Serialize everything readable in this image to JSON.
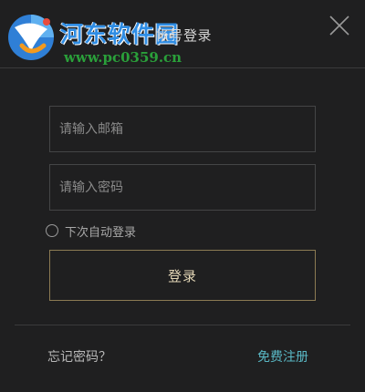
{
  "window": {
    "title": "帐号登录",
    "close_icon": "close-icon"
  },
  "watermark": {
    "name": "河东软件园",
    "url": "www.pc0359.cn",
    "logo_icon": "globe-logo-icon"
  },
  "form": {
    "email_placeholder": "请输入邮箱",
    "email_value": "",
    "password_placeholder": "请输入密码",
    "password_value": "",
    "remember_label": "下次自动登录",
    "remember_checked": false,
    "login_label": "登录"
  },
  "footer": {
    "forgot_label": "忘记密码？",
    "register_label": "免费注册"
  },
  "colors": {
    "background": "#1f1f20",
    "button_border": "#8c7b53",
    "register_link": "#59b7c4",
    "watermark_blue": "#2f8de4",
    "watermark_green": "#2aa03a"
  }
}
